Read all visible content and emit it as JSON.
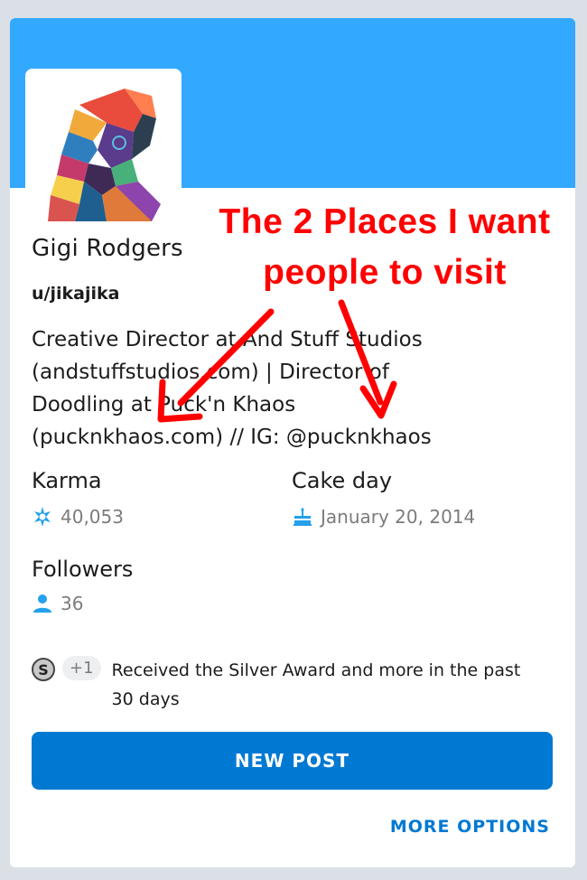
{
  "profile": {
    "display_name": "Gigi Rodgers",
    "username": "u/jikajika",
    "bio": "Creative Director at And Stuff Studios\n(andstuffstudios.com) | Director of\nDoodling at Puck'n Khaos\n(pucknkhaos.com) // IG: @pucknkhaos"
  },
  "stats": {
    "karma_label": "Karma",
    "karma_value": "40,053",
    "cake_day_label": "Cake day",
    "cake_day_value": "January 20, 2014",
    "followers_label": "Followers",
    "followers_value": "36"
  },
  "award": {
    "coin_letter": "S",
    "plus_count": "+1",
    "text": "Received the Silver Award and more in the past 30 days"
  },
  "actions": {
    "new_post_label": "NEW POST",
    "more_options_label": "MORE OPTIONS"
  },
  "annotation": {
    "line1": "The 2 Places I want",
    "line2": "people to visit",
    "color": "#ff0000"
  },
  "colors": {
    "banner": "#33a8ff",
    "accent": "#0079d3",
    "page_bg": "#dae0e6"
  },
  "icons": {
    "karma": "karma-icon",
    "cake": "cake-icon",
    "followers": "person-icon",
    "award": "silver-award-icon"
  }
}
